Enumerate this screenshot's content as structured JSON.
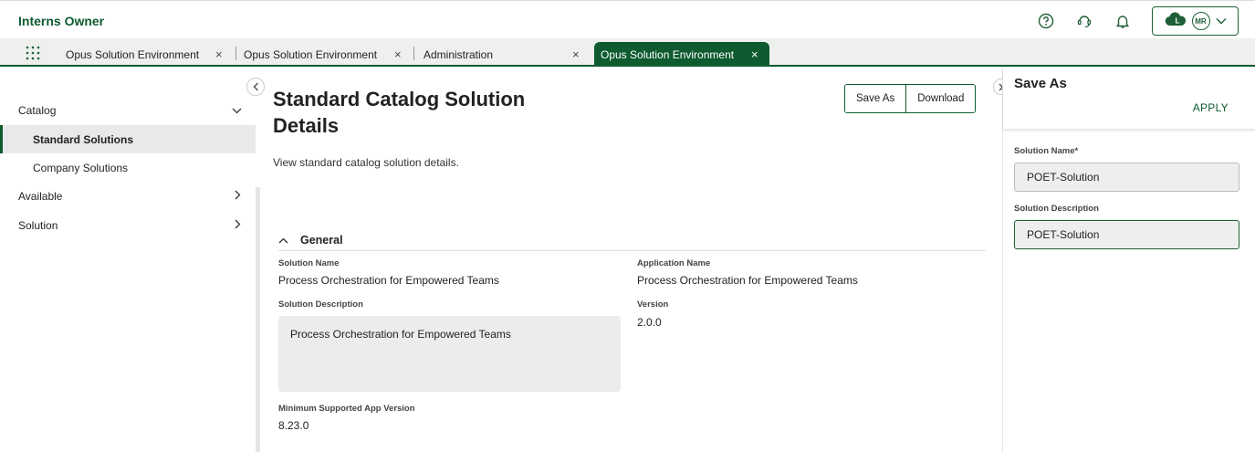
{
  "header": {
    "app_title": "Interns Owner",
    "icons": [
      "help-icon",
      "support-icon",
      "bell-icon",
      "cloud-icon"
    ],
    "avatar_initials": "MR"
  },
  "tabs": [
    {
      "label": "Opus Solution Environment",
      "active": false
    },
    {
      "label": "Opus Solution Environment",
      "active": false
    },
    {
      "label": "Administration",
      "active": false
    },
    {
      "label": "Opus Solution Environment",
      "active": true
    }
  ],
  "tab_close_glyph": "×",
  "sidebar": {
    "items": [
      {
        "label": "Catalog",
        "chevron": "⌄"
      },
      {
        "label": "Standard Solutions"
      },
      {
        "label": "Company Solutions"
      },
      {
        "label": "Available",
        "chevron": "›"
      },
      {
        "label": "Solution",
        "chevron": "›"
      }
    ]
  },
  "main": {
    "title": "Standard Catalog Solution Details",
    "description": "View standard catalog solution details.",
    "buttons": {
      "save_as": "Save As",
      "download": "Download"
    },
    "section": {
      "title": "General",
      "fields": {
        "solution_name_label": "Solution Name",
        "solution_name_value": "Process Orchestration for Empowered Teams",
        "application_name_label": "Application Name",
        "application_name_value": "Process Orchestration for Empowered Teams",
        "solution_description_label": "Solution Description",
        "solution_description_value": "Process Orchestration for Empowered Teams",
        "version_label": "Version",
        "version_value": "2.0.0",
        "min_app_version_label": "Minimum Supported App Version",
        "min_app_version_value": "8.23.0"
      }
    }
  },
  "right_panel": {
    "title": "Save As",
    "apply_label": "APPLY",
    "solution_name_label": "Solution Name*",
    "solution_name_value": "POET-Solution",
    "solution_description_label": "Solution Description",
    "solution_description_value": "POET-Solution"
  },
  "colors": {
    "brand": "#0d5b2f",
    "panel_bg": "#eeeeee"
  }
}
